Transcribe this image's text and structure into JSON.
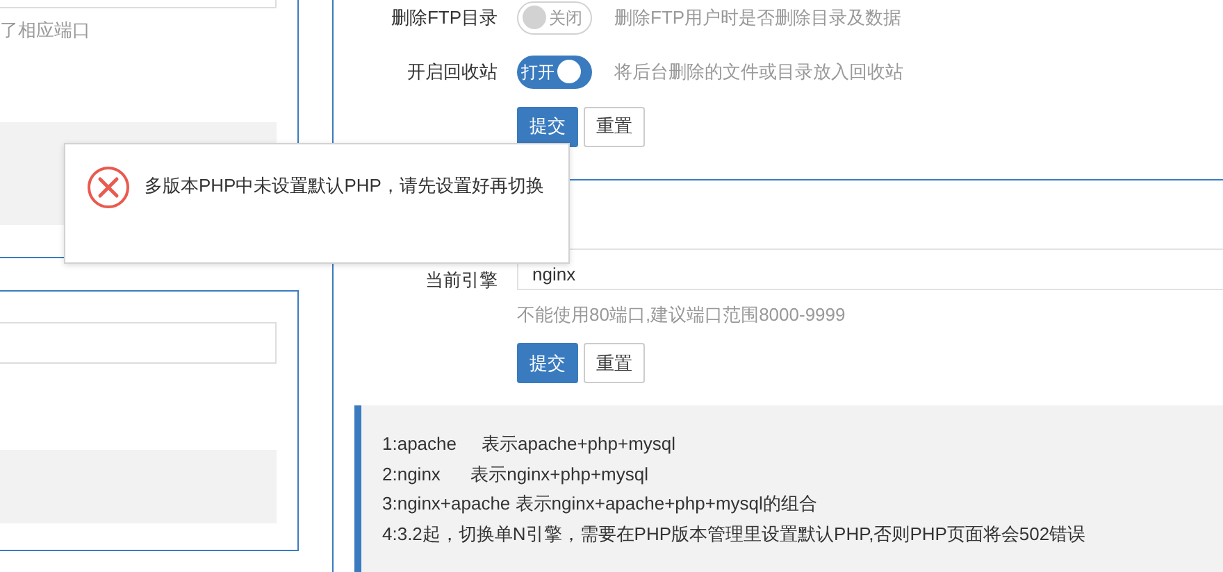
{
  "left_panel": {
    "hint": "了相应端口"
  },
  "ftp_settings": {
    "rows": [
      {
        "label": "删除FTP目录",
        "switch_text": "关闭",
        "on": false,
        "description": "删除FTP用户时是否删除目录及数据"
      },
      {
        "label": "开启回收站",
        "switch_text": "打开",
        "on": true,
        "description": "将后台删除的文件或目录放入回收站"
      }
    ],
    "buttons": [
      {
        "label": "提交",
        "kind": "primary"
      },
      {
        "label": "重置",
        "kind": "default"
      }
    ]
  },
  "engine": {
    "label": "当前引擎",
    "value": "nginx",
    "hint": "不能使用80端口,建议端口范围8000-9999",
    "buttons": [
      {
        "label": "提交",
        "kind": "primary"
      },
      {
        "label": "重置",
        "kind": "default"
      }
    ],
    "notes": [
      "1:apache     表示apache+php+mysql",
      "2:nginx      表示nginx+php+mysql",
      "3:nginx+apache 表示nginx+apache+php+mysql的组合",
      "4:3.2起，切换单N引擎，需要在PHP版本管理里设置默认PHP,否则PHP页面将会502错误"
    ]
  },
  "dialog": {
    "message": "多版本PHP中未设置默认PHP，请先设置好再切换"
  }
}
